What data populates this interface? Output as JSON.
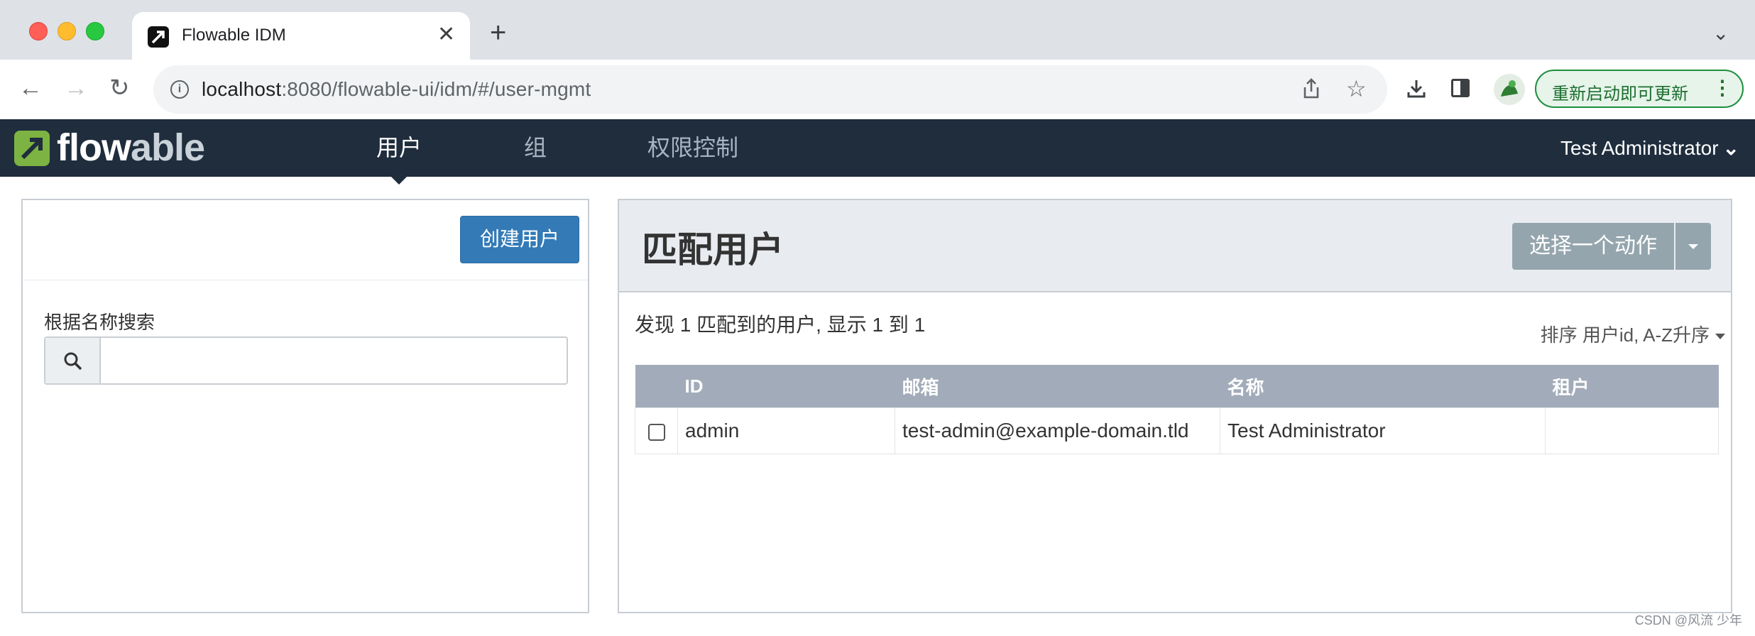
{
  "browser": {
    "tab_title": "Flowable IDM",
    "url_host": "localhost",
    "url_rest": ":8080/flowable-ui/idm/#/user-mgmt",
    "update_label": "重新启动即可更新"
  },
  "navbar": {
    "logo_flow": "flow",
    "logo_able": "able",
    "items": [
      {
        "label": "用户",
        "active": true
      },
      {
        "label": "组",
        "active": false
      },
      {
        "label": "权限控制",
        "active": false
      }
    ],
    "user": "Test Administrator"
  },
  "left_panel": {
    "create_button": "创建用户",
    "search_label": "根据名称搜索",
    "search_value": ""
  },
  "right_panel": {
    "title": "匹配用户",
    "action_button": "选择一个动作",
    "result_count": "发现 1 匹配到的用户, 显示 1 到 1",
    "sort": "排序 用户id, A-Z升序",
    "columns": [
      "ID",
      "邮箱",
      "名称",
      "租户"
    ],
    "rows": [
      {
        "id": "admin",
        "email": "test-admin@example-domain.tld",
        "name": "Test Administrator",
        "tenant": ""
      }
    ]
  },
  "watermark": "CSDN @风流 少年"
}
